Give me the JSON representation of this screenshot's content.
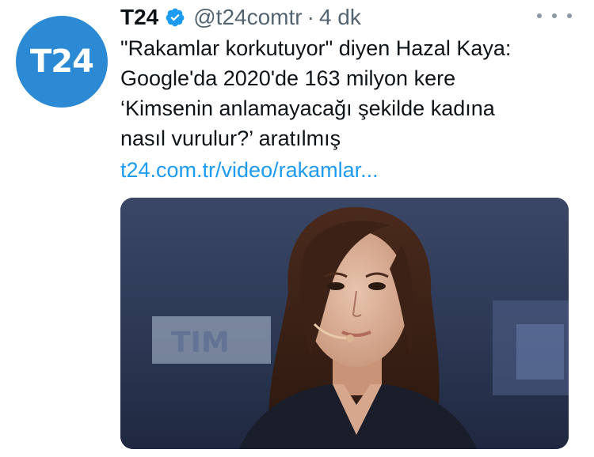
{
  "account": {
    "avatar_text": "T24",
    "display_name": "T24",
    "handle": "@t24comtr",
    "separator": "·",
    "time": "4 dk"
  },
  "tweet": {
    "text": "\"Rakamlar korkutuyor\" diyen Hazal Kaya:\nGoogle'da 2020'de 163 milyon kere\n‘Kimsenin anlamayacağı şekilde kadına\nnasıl vurulur?’ aratılmış",
    "link": "t24.com.tr/video/rakamlar..."
  },
  "media": {
    "backdrop_text": "TIM"
  },
  "colors": {
    "avatar_bg": "#2b8ad3",
    "verified": "#1d9bf0",
    "link": "#1d9bf0",
    "secondary_text": "#536471"
  },
  "icons": {
    "verified": "verified-badge-icon",
    "more": "more-options-icon"
  }
}
